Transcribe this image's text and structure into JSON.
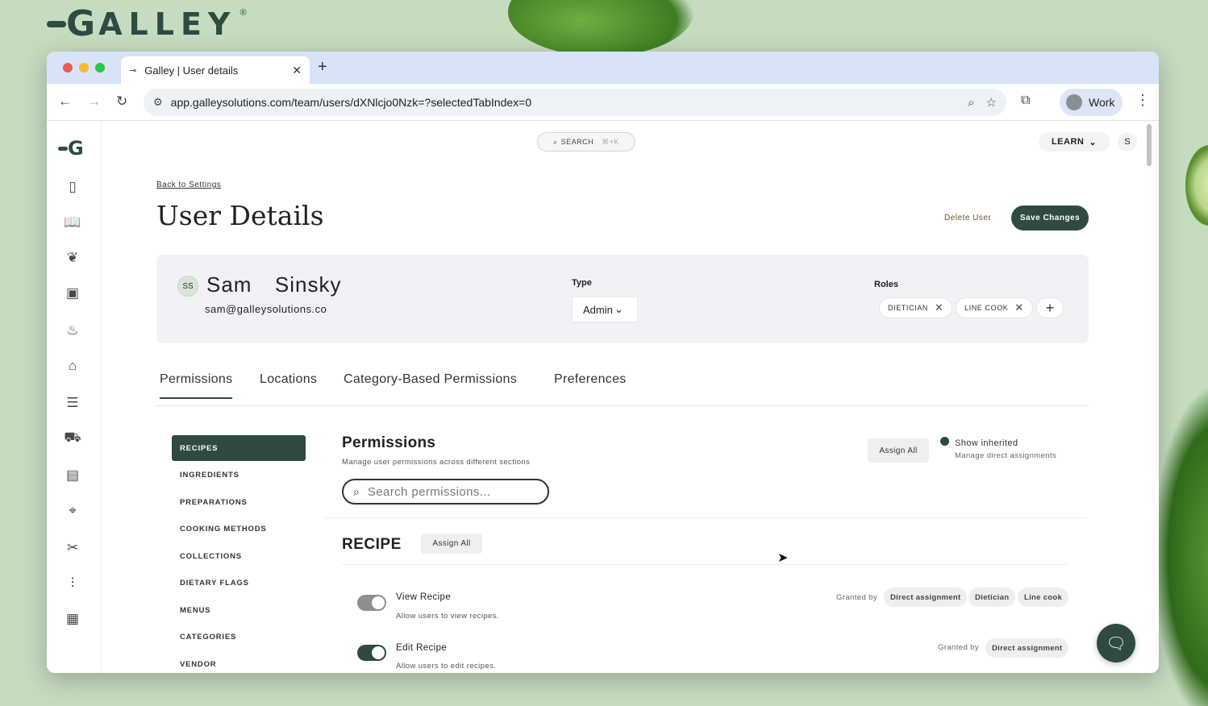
{
  "brand": {
    "name": "ALLEY",
    "logo_letter": "G",
    "reg": "®"
  },
  "browser": {
    "tab_title": "Galley | User details",
    "url": "app.galleysolutions.com/team/users/dXNlcjo0Nzk=?selectedTabIndex=0",
    "profile_label": "Work"
  },
  "app": {
    "search_label": "SEARCH",
    "search_shortcut": "⌘+K",
    "learn_label": "LEARN",
    "user_initial": "S",
    "rail_logo_letter": "G"
  },
  "header": {
    "back_link": "Back to Settings",
    "title": "User Details",
    "delete_label": "Delete User",
    "save_label": "Save Changes"
  },
  "user": {
    "initials": "SS",
    "name": "Sam  Sinsky",
    "email": "sam@galleysolutions.co",
    "type_label": "Type",
    "type_value": "Admin",
    "roles_label": "Roles",
    "roles": [
      "DIETICIAN",
      "LINE COOK"
    ]
  },
  "tabs": [
    "Permissions",
    "Locations",
    "Category-Based Permissions",
    "Preferences"
  ],
  "sidebar": [
    "RECIPES",
    "INGREDIENTS",
    "PREPARATIONS",
    "COOKING METHODS",
    "COLLECTIONS",
    "DIETARY FLAGS",
    "MENUS",
    "CATEGORIES",
    "VENDOR"
  ],
  "permissions": {
    "title": "Permissions",
    "subtitle": "Manage user permissions across different sections",
    "assign_all": "Assign All",
    "show_inherited": "Show inherited",
    "manage_direct": "Manage direct assignments",
    "search_placeholder": "Search permissions...",
    "section_title": "RECIPE",
    "section_assign": "Assign All",
    "granted_by": "Granted by",
    "items": [
      {
        "name": "View Recipe",
        "desc": "Allow users to view recipes.",
        "enabled": false,
        "granted": [
          "Direct assignment",
          "Dietician",
          "Line cook"
        ]
      },
      {
        "name": "Edit Recipe",
        "desc": "Allow users to edit recipes.",
        "enabled": true,
        "granted": [
          "Direct assignment"
        ]
      }
    ]
  }
}
